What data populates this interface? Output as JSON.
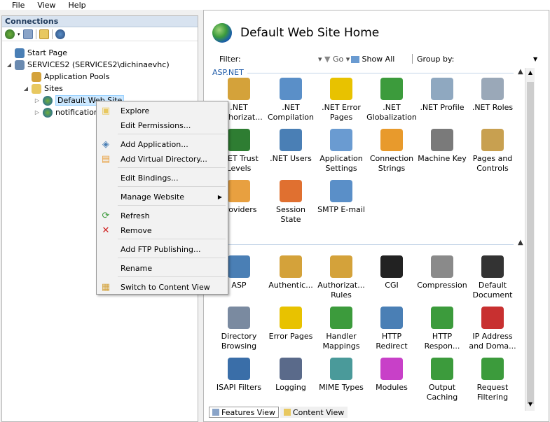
{
  "menubar": [
    "File",
    "View",
    "Help"
  ],
  "connections": {
    "title": "Connections",
    "tree": [
      {
        "label": "Start Page",
        "icon": "start-page-icon"
      },
      {
        "label": "SERVICES2 (SERVICES2\\dichinaevhc)",
        "icon": "server-icon"
      },
      {
        "label": "Application Pools",
        "icon": "app-pools-icon"
      },
      {
        "label": "Sites",
        "icon": "sites-folder-icon"
      },
      {
        "label": "Default Web Site",
        "icon": "website-icon"
      },
      {
        "label": "notification",
        "icon": "website-icon"
      }
    ]
  },
  "main": {
    "title": "Default Web Site Home",
    "filter_label": "Filter:",
    "go_label": "Go",
    "show_all_label": "Show All",
    "group_by_label": "Group by:",
    "groups": [
      {
        "name": "ASP.NET"
      },
      {
        "name": ""
      }
    ],
    "aspnet_features": [
      {
        "label": ".NET Authorizat...",
        "icon": "net-authorization-icon",
        "color": "#d4a23a"
      },
      {
        "label": ".NET Compilation",
        "icon": "net-compilation-icon",
        "color": "#5a8fc8"
      },
      {
        "label": ".NET Error Pages",
        "icon": "net-error-pages-icon",
        "color": "#e8c200"
      },
      {
        "label": ".NET Globalization",
        "icon": "net-globalization-icon",
        "color": "#3c9b3c"
      },
      {
        "label": ".NET Profile",
        "icon": "net-profile-icon",
        "color": "#8fa8c0"
      },
      {
        "label": ".NET Roles",
        "icon": "net-roles-icon",
        "color": "#9aa8b8"
      },
      {
        "label": ".NET Trust Levels",
        "icon": "net-trust-levels-icon",
        "color": "#2e7d32"
      },
      {
        "label": ".NET Users",
        "icon": "net-users-icon",
        "color": "#4a7fb5"
      },
      {
        "label": "Application Settings",
        "icon": "application-settings-icon",
        "color": "#6a9bd1"
      },
      {
        "label": "Connection Strings",
        "icon": "connection-strings-icon",
        "color": "#e89a2c"
      },
      {
        "label": "Machine Key",
        "icon": "machine-key-icon",
        "color": "#7a7a7a"
      },
      {
        "label": "Pages and Controls",
        "icon": "pages-controls-icon",
        "color": "#c8a050"
      },
      {
        "label": "Providers",
        "icon": "providers-icon",
        "color": "#e8a040"
      },
      {
        "label": "Session State",
        "icon": "session-state-icon",
        "color": "#e07030"
      },
      {
        "label": "SMTP E-mail",
        "icon": "smtp-email-icon",
        "color": "#5a8fc8"
      }
    ],
    "iis_features": [
      {
        "label": "ASP",
        "icon": "asp-icon",
        "color": "#4a7fb5"
      },
      {
        "label": "Authentic...",
        "icon": "authentication-icon",
        "color": "#d4a23a"
      },
      {
        "label": "Authorizat... Rules",
        "icon": "authorization-rules-icon",
        "color": "#d4a23a"
      },
      {
        "label": "CGI",
        "icon": "cgi-icon",
        "color": "#222222"
      },
      {
        "label": "Compression",
        "icon": "compression-icon",
        "color": "#8a8a8a"
      },
      {
        "label": "Default Document",
        "icon": "default-document-icon",
        "color": "#333333"
      },
      {
        "label": "Directory Browsing",
        "icon": "directory-browsing-icon",
        "color": "#7a8aa0"
      },
      {
        "label": "Error Pages",
        "icon": "error-pages-icon",
        "color": "#e8c200"
      },
      {
        "label": "Handler Mappings",
        "icon": "handler-mappings-icon",
        "color": "#3c9b3c"
      },
      {
        "label": "HTTP Redirect",
        "icon": "http-redirect-icon",
        "color": "#4a7fb5"
      },
      {
        "label": "HTTP Respon...",
        "icon": "http-response-icon",
        "color": "#3c9b3c"
      },
      {
        "label": "IP Address and Doma...",
        "icon": "ip-address-icon",
        "color": "#c83030"
      },
      {
        "label": "ISAPI Filters",
        "icon": "isapi-filters-icon",
        "color": "#3a6ea8"
      },
      {
        "label": "Logging",
        "icon": "logging-icon",
        "color": "#5a6a8a"
      },
      {
        "label": "MIME Types",
        "icon": "mime-types-icon",
        "color": "#4a9a9a"
      },
      {
        "label": "Modules",
        "icon": "modules-icon",
        "color": "#c840c8"
      },
      {
        "label": "Output Caching",
        "icon": "output-caching-icon",
        "color": "#3c9b3c"
      },
      {
        "label": "Request Filtering",
        "icon": "request-filtering-icon",
        "color": "#3c9b3c"
      }
    ],
    "view_tabs": [
      {
        "label": "Features View",
        "icon": "features-view-icon"
      },
      {
        "label": "Content View",
        "icon": "content-view-icon"
      }
    ]
  },
  "context_menu": [
    {
      "label": "Explore",
      "icon": "explore-icon"
    },
    {
      "label": "Edit Permissions...",
      "icon": ""
    },
    {
      "label": "Add Application...",
      "icon": "add-application-icon"
    },
    {
      "label": "Add Virtual Directory...",
      "icon": "add-virtual-directory-icon"
    },
    {
      "label": "Edit Bindings...",
      "icon": ""
    },
    {
      "label": "Manage Website",
      "icon": "",
      "submenu": true
    },
    {
      "label": "Refresh",
      "icon": "refresh-icon"
    },
    {
      "label": "Remove",
      "icon": "remove-icon"
    },
    {
      "label": "Add FTP Publishing...",
      "icon": ""
    },
    {
      "label": "Rename",
      "icon": ""
    },
    {
      "label": "Switch to Content View",
      "icon": "content-view-icon"
    }
  ]
}
